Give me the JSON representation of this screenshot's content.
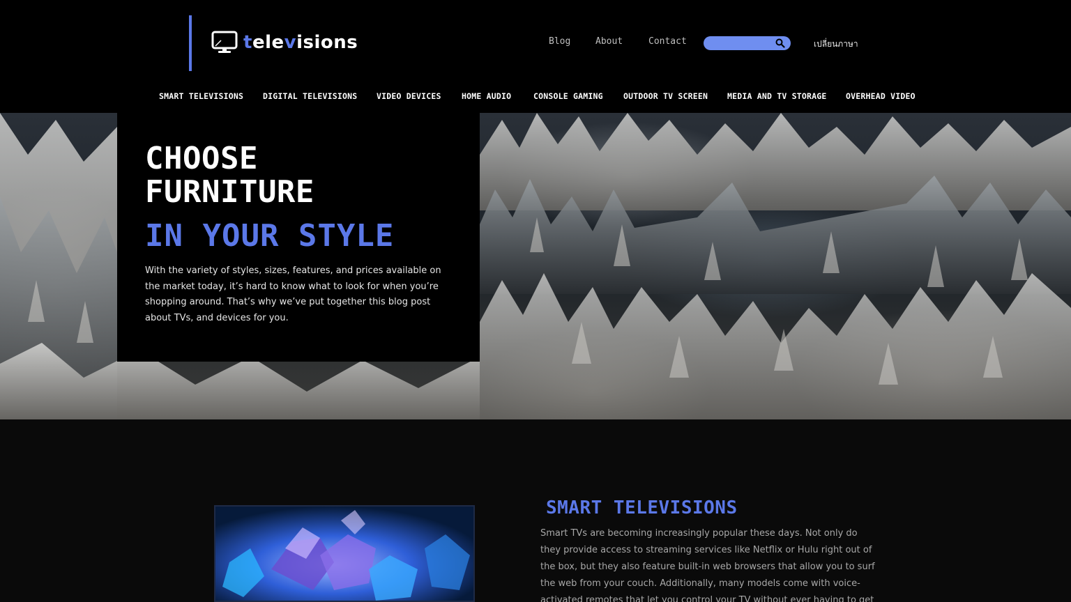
{
  "header": {
    "logo": {
      "prefix": "t",
      "part1": "ele",
      "accent": "v",
      "part2": "isions"
    },
    "top_links": [
      {
        "label": "Blog"
      },
      {
        "label": "About"
      },
      {
        "label": "Contact"
      }
    ],
    "search": {
      "placeholder": "",
      "value": ""
    },
    "language_label": "เปลี่ยนภาษา"
  },
  "nav": {
    "items": [
      {
        "label": "SMART TELEVISIONS"
      },
      {
        "label": "DIGITAL TELEVISIONS"
      },
      {
        "label": "VIDEO DEVICES"
      },
      {
        "label": "HOME AUDIO"
      },
      {
        "label": "CONSOLE GAMING"
      },
      {
        "label": "OUTDOOR TV SCREEN"
      },
      {
        "label": "MEDIA AND TV STORAGE"
      },
      {
        "label": "OVERHEAD VIDEO"
      }
    ]
  },
  "hero": {
    "title_line1": "CHOOSE",
    "title_line2": "FURNITURE",
    "subtitle": "IN YOUR STYLE",
    "body": "With the variety of styles, sizes, features, and prices available on the market today, it’s hard to know what to look for when you’re shopping around. That’s why we’ve put together this blog post about TVs, and devices for you."
  },
  "section": {
    "title": "SMART TELEVISIONS",
    "body": "Smart TVs are becoming increasingly popular these days. Not only do they provide access to streaming services like Netflix or Hulu right out of the box, but they also feature built-in web browsers that allow you to surf the web from your couch. Additionally, many models come with voice-activated remotes that let you control your TV without ever having to get up off the"
  },
  "colors": {
    "accent": "#5b78e8",
    "search_bg": "#6f8ef0",
    "background": "#000000"
  },
  "icons": {
    "logo": "monitor-icon",
    "search": "search-icon"
  }
}
